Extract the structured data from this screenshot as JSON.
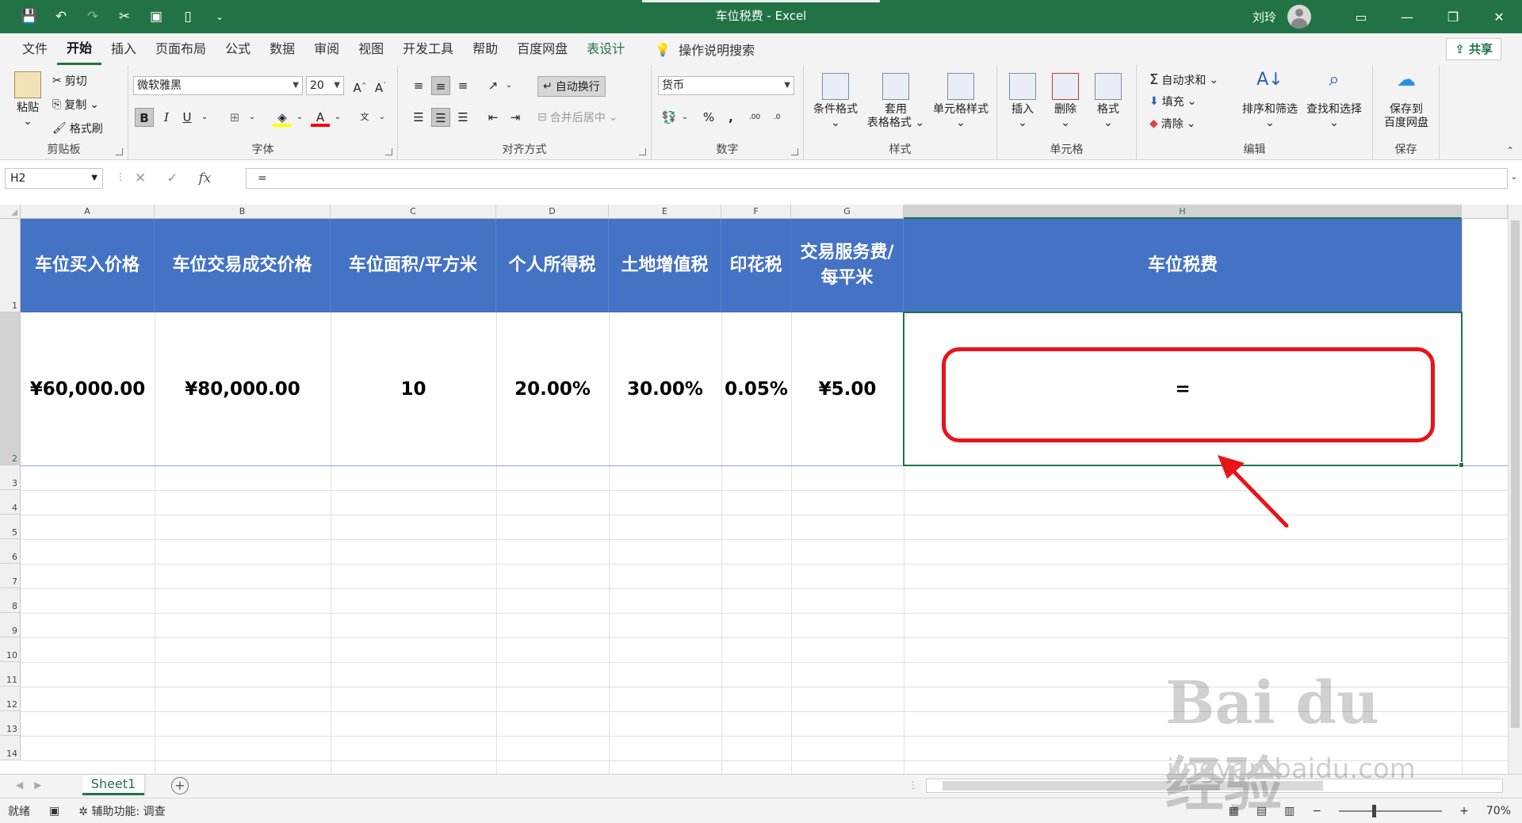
{
  "window": {
    "title": "车位税费  -  Excel",
    "user": "刘玲"
  },
  "menu_tabs": [
    "文件",
    "开始",
    "插入",
    "页面布局",
    "公式",
    "数据",
    "审阅",
    "视图",
    "开发工具",
    "帮助",
    "百度网盘",
    "表设计"
  ],
  "search_hint": "操作说明搜索",
  "share_label": "共享",
  "ribbon": {
    "clipboard": {
      "paste": "粘贴",
      "cut": "剪切",
      "copy": "复制",
      "format_painter": "格式刷",
      "label": "剪贴板"
    },
    "font": {
      "name": "微软雅黑",
      "size": "20",
      "label": "字体",
      "bold": "B",
      "italic": "I",
      "underline": "U"
    },
    "alignment": {
      "wrap": "自动换行",
      "merge": "合并后居中",
      "label": "对齐方式"
    },
    "number": {
      "format": "货币",
      "percent": "%",
      "comma": ",",
      "label": "数字"
    },
    "styles": {
      "conditional": "条件格式",
      "table_format_1": "套用",
      "table_format_2": "表格格式",
      "cell_styles": "单元格样式",
      "label": "样式"
    },
    "cells": {
      "insert": "插入",
      "delete": "删除",
      "format": "格式",
      "label": "单元格"
    },
    "editing": {
      "autosum": "自动求和",
      "fill": "填充",
      "clear": "清除",
      "sort": "排序和筛选",
      "find": "查找和选择",
      "label": "编辑"
    },
    "save": {
      "save_1": "保存到",
      "save_2": "百度网盘",
      "label": "保存"
    }
  },
  "formula_bar": {
    "name_box": "H2",
    "formula": "="
  },
  "columns": [
    "A",
    "B",
    "C",
    "D",
    "E",
    "F",
    "G",
    "H"
  ],
  "rows": [
    "1",
    "2",
    "3",
    "4",
    "5",
    "6",
    "7",
    "8",
    "9",
    "10",
    "11",
    "12",
    "13",
    "14"
  ],
  "header_row": [
    "车位买入价格",
    "车位交易成交价格",
    "车位面积/平方米",
    "个人所得税",
    "土地增值税",
    "印花税",
    "交易服务费/\n每平米",
    "车位税费"
  ],
  "data_row": [
    "¥60,000.00",
    "¥80,000.00",
    "10",
    "20.00%",
    "30.00%",
    "0.05%",
    "¥5.00",
    "="
  ],
  "sheet_tab": "Sheet1",
  "status": {
    "ready": "就绪",
    "accessibility": "辅助功能: 调查",
    "zoom": "70%"
  },
  "watermark": {
    "line1": "Bai du 经验",
    "line2": "jingyan.baidu.com"
  },
  "colors": {
    "excel_green": "#217346",
    "header_fill": "#4472c4",
    "annotation_red": "#e8141a"
  }
}
